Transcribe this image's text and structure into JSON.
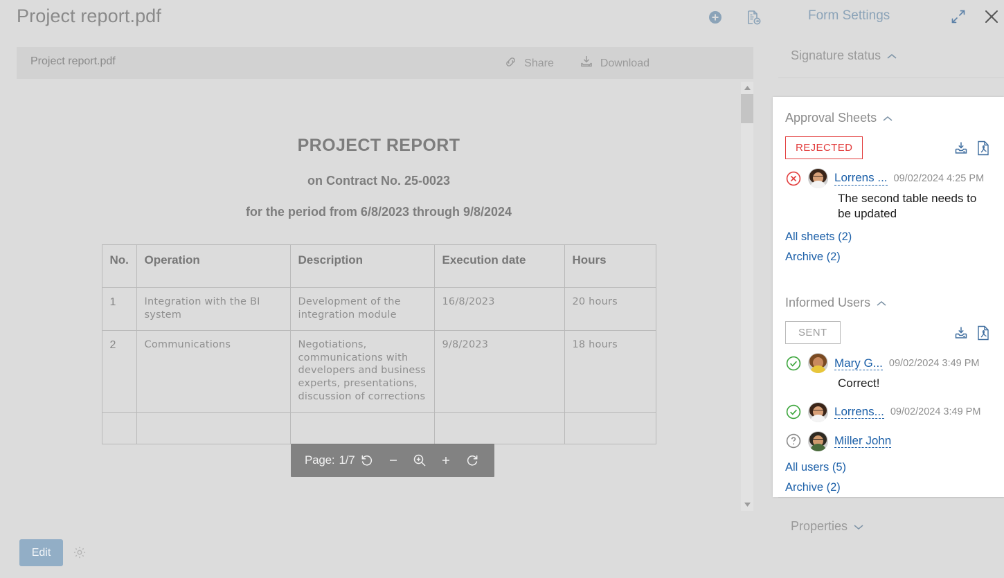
{
  "window": {
    "title": "Project report.pdf",
    "panel_title": "Form Settings",
    "icons": {
      "add": "plus-circle-icon",
      "doc_send": "document-send-icon",
      "expand": "expand-arrows-icon",
      "close": "close-icon"
    }
  },
  "document_toolbar": {
    "filename": "Project report.pdf",
    "share_label": "Share",
    "download_label": "Download"
  },
  "document": {
    "title": "PROJECT REPORT",
    "subtitle": "on Contract No. 25-0023",
    "period": "for the period from 6/8/2023 through 9/8/2024",
    "table": {
      "headers": [
        "No.",
        "Operation",
        "Description",
        "Execution date",
        "Hours"
      ],
      "rows": [
        {
          "no": "1",
          "operation": "Integration with the BI system",
          "description": "Development of the integration module",
          "date": "16/8/2023",
          "hours": "20 hours"
        },
        {
          "no": "2",
          "operation": "Communications",
          "description": "Negotiations, communications with developers and business experts, presentations, discussion of corrections",
          "date": "9/8/2023",
          "hours": "18 hours"
        }
      ]
    }
  },
  "page_tools": {
    "page_label": "Page:",
    "page_value": "1/7",
    "rotate_left": "rotate-left-icon",
    "zoom_out": "minus-icon",
    "magnifier": "magnifier-icon",
    "zoom_in": "plus-icon",
    "rotate_right": "rotate-right-icon"
  },
  "bottom": {
    "edit_label": "Edit",
    "settings_icon": "gear-icon"
  },
  "panel": {
    "signature_status": {
      "label": "Signature status",
      "expanded": true
    },
    "approval_sheets": {
      "label": "Approval Sheets",
      "expanded": true,
      "status_badge": "REJECTED",
      "badge_color": "#e23b3b",
      "entries": [
        {
          "status": "rejected",
          "name": "Lorrens ...",
          "time": "09/02/2024 4:25 PM",
          "comment": "The second table needs to be updated"
        }
      ],
      "links": [
        "All sheets (2)",
        "Archive (2)"
      ]
    },
    "informed_users": {
      "label": "Informed Users",
      "expanded": true,
      "status_badge": "SENT",
      "badge_color": "#9b9b9b",
      "entries": [
        {
          "status": "approved",
          "name": "Mary G...",
          "time": "09/02/2024 3:49 PM",
          "comment": "Correct!"
        },
        {
          "status": "approved",
          "name": "Lorrens...",
          "time": "09/02/2024 3:49 PM",
          "comment": ""
        },
        {
          "status": "pending",
          "name": "Miller John",
          "time": "",
          "comment": ""
        }
      ],
      "links": [
        "All users (5)",
        "Archive (2)"
      ]
    },
    "properties": {
      "label": "Properties",
      "expanded": false
    }
  },
  "colors": {
    "accent_blue": "#8ba3b8",
    "link_blue": "#1b5fa8",
    "icon_blue": "#3d6c9e",
    "reject_red": "#e23b3b",
    "approve_green": "#3aa53a",
    "background": "#dcdcdc"
  }
}
